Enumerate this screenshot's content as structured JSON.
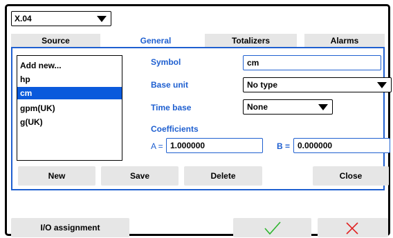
{
  "device_select": {
    "value": "X.04"
  },
  "tabs": [
    {
      "label": "Source",
      "active": false
    },
    {
      "label": "General",
      "active": true
    },
    {
      "label": "Totalizers",
      "active": false
    },
    {
      "label": "Alarms",
      "active": false
    }
  ],
  "unit_list": {
    "items": [
      "Add new...",
      "hp",
      "cm",
      "gpm(UK)",
      "g(UK)"
    ],
    "selected": "cm"
  },
  "form": {
    "symbol_label": "Symbol",
    "symbol_value": "cm",
    "base_unit_label": "Base unit",
    "base_unit_value": "No type",
    "time_base_label": "Time base",
    "time_base_value": "None",
    "coefficients_label": "Coefficients",
    "a_label": "A =",
    "a_value": "1.000000",
    "b_label": "B =",
    "b_value": "0.000000"
  },
  "panel_buttons": {
    "new": "New",
    "save": "Save",
    "delete": "Delete",
    "close": "Close"
  },
  "footer": {
    "io_assignment": "I/O assignment",
    "confirm_icon": "check-icon",
    "cancel_icon": "x-icon"
  },
  "colors": {
    "accent": "#1e5fd0",
    "selection": "#0a5adc",
    "confirm": "#2db52d",
    "cancel": "#e02020",
    "button_bg": "#e6e6e6"
  }
}
